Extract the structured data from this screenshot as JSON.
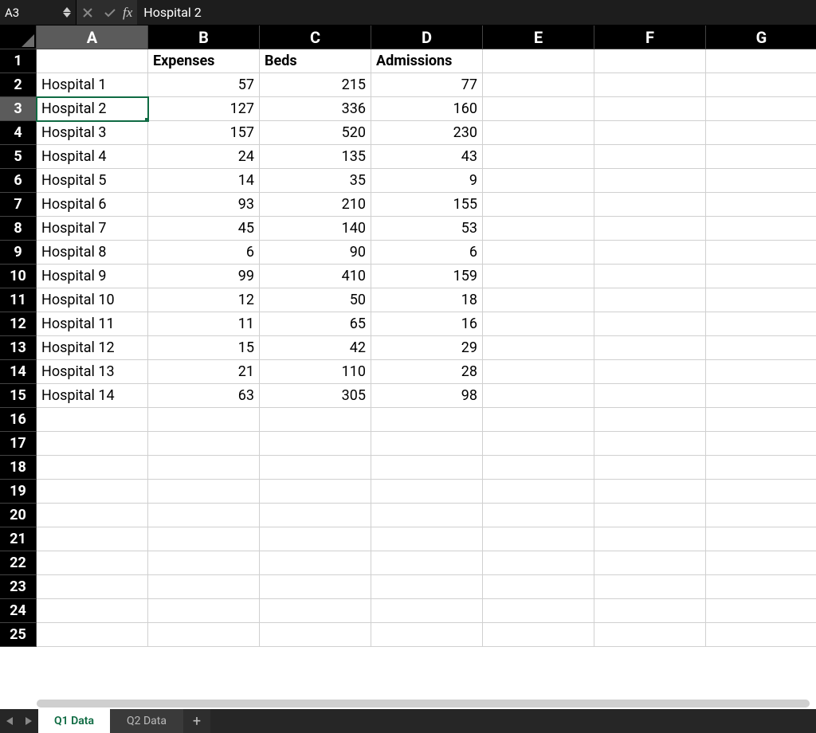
{
  "formula_bar": {
    "cell_ref": "A3",
    "fx_label": "fx",
    "value": "Hospital 2"
  },
  "columns": [
    "A",
    "B",
    "C",
    "D",
    "E",
    "F",
    "G"
  ],
  "selected_col": "A",
  "selected_row": 3,
  "visible_row_start": 1,
  "visible_row_end": 25,
  "headers": {
    "B1": "Expenses",
    "C1": "Beds",
    "D1": "Admissions"
  },
  "rows": [
    {
      "label": "Hospital 1",
      "expenses": 57,
      "beds": 215,
      "admissions": 77
    },
    {
      "label": "Hospital 2",
      "expenses": 127,
      "beds": 336,
      "admissions": 160
    },
    {
      "label": "Hospital 3",
      "expenses": 157,
      "beds": 520,
      "admissions": 230
    },
    {
      "label": "Hospital 4",
      "expenses": 24,
      "beds": 135,
      "admissions": 43
    },
    {
      "label": "Hospital 5",
      "expenses": 14,
      "beds": 35,
      "admissions": 9
    },
    {
      "label": "Hospital 6",
      "expenses": 93,
      "beds": 210,
      "admissions": 155
    },
    {
      "label": "Hospital 7",
      "expenses": 45,
      "beds": 140,
      "admissions": 53
    },
    {
      "label": "Hospital 8",
      "expenses": 6,
      "beds": 90,
      "admissions": 6
    },
    {
      "label": "Hospital 9",
      "expenses": 99,
      "beds": 410,
      "admissions": 159
    },
    {
      "label": "Hospital 10",
      "expenses": 12,
      "beds": 50,
      "admissions": 18
    },
    {
      "label": "Hospital 11",
      "expenses": 11,
      "beds": 65,
      "admissions": 16
    },
    {
      "label": "Hospital 12",
      "expenses": 15,
      "beds": 42,
      "admissions": 29
    },
    {
      "label": "Hospital 13",
      "expenses": 21,
      "beds": 110,
      "admissions": 28
    },
    {
      "label": "Hospital 14",
      "expenses": 63,
      "beds": 305,
      "admissions": 98
    }
  ],
  "tabs": {
    "items": [
      "Q1 Data",
      "Q2 Data"
    ],
    "active": 0
  },
  "chart_data": {
    "type": "table",
    "title": "",
    "columns": [
      "",
      "Expenses",
      "Beds",
      "Admissions"
    ],
    "categories": [
      "Hospital 1",
      "Hospital 2",
      "Hospital 3",
      "Hospital 4",
      "Hospital 5",
      "Hospital 6",
      "Hospital 7",
      "Hospital 8",
      "Hospital 9",
      "Hospital 10",
      "Hospital 11",
      "Hospital 12",
      "Hospital 13",
      "Hospital 14"
    ],
    "series": [
      {
        "name": "Expenses",
        "values": [
          57,
          127,
          157,
          24,
          14,
          93,
          45,
          6,
          99,
          12,
          11,
          15,
          21,
          63
        ]
      },
      {
        "name": "Beds",
        "values": [
          215,
          336,
          520,
          135,
          35,
          210,
          140,
          90,
          410,
          50,
          65,
          42,
          110,
          305
        ]
      },
      {
        "name": "Admissions",
        "values": [
          77,
          160,
          230,
          43,
          9,
          155,
          53,
          6,
          159,
          18,
          16,
          29,
          28,
          98
        ]
      }
    ]
  }
}
